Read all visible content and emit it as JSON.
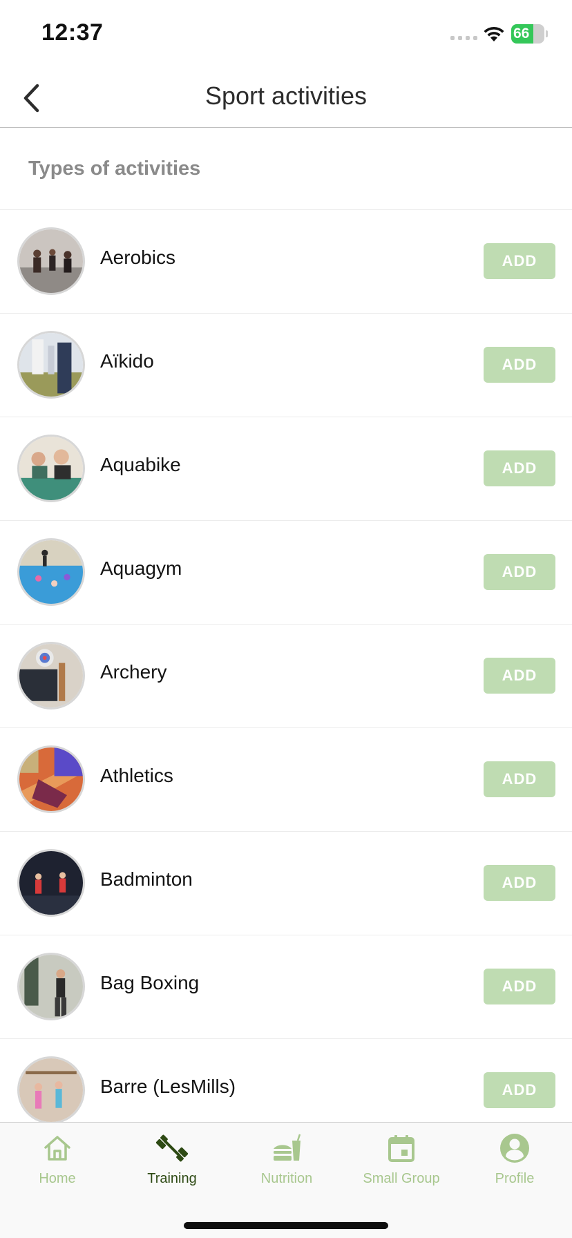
{
  "status_bar": {
    "time": "12:37",
    "battery_level": "66",
    "battery_fraction": 0.66
  },
  "header": {
    "title": "Sport activities",
    "back_icon": "chevron-left-icon"
  },
  "section": {
    "title": "Types of activities"
  },
  "colors": {
    "accent_light": "#bfdcb2",
    "tab_active": "#2e4a14",
    "tab_inactive": "#a8c78e",
    "battery_green": "#34c759"
  },
  "activities": [
    {
      "name": "Aerobics",
      "action": "ADD"
    },
    {
      "name": "Aïkido",
      "action": "ADD"
    },
    {
      "name": "Aquabike",
      "action": "ADD"
    },
    {
      "name": "Aquagym",
      "action": "ADD"
    },
    {
      "name": "Archery",
      "action": "ADD"
    },
    {
      "name": "Athletics",
      "action": "ADD"
    },
    {
      "name": "Badminton",
      "action": "ADD"
    },
    {
      "name": "Bag Boxing",
      "action": "ADD"
    },
    {
      "name": "Barre (LesMills)",
      "action": "ADD"
    }
  ],
  "tab_bar": {
    "active_tab": "Training",
    "tabs": [
      {
        "label": "Home",
        "icon": "home-icon"
      },
      {
        "label": "Training",
        "icon": "dumbbell-icon"
      },
      {
        "label": "Nutrition",
        "icon": "burger-drink-icon"
      },
      {
        "label": "Small Group",
        "icon": "calendar-icon"
      },
      {
        "label": "Profile",
        "icon": "user-circle-icon"
      }
    ]
  }
}
